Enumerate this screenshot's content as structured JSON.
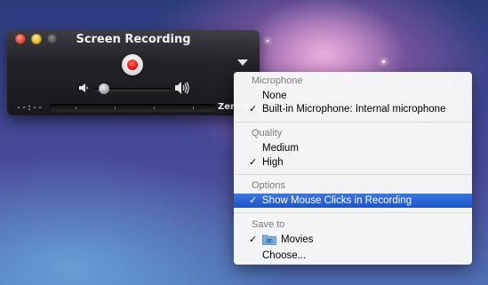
{
  "window": {
    "title": "Screen Recording",
    "time": "--:--",
    "size": "Zero KB"
  },
  "menu": {
    "sections": [
      {
        "header": "Microphone",
        "items": [
          {
            "label": "None",
            "checked": false
          },
          {
            "label": "Built-in Microphone: Internal microphone",
            "checked": true
          }
        ]
      },
      {
        "header": "Quality",
        "items": [
          {
            "label": "Medium",
            "checked": false
          },
          {
            "label": "High",
            "checked": true
          }
        ]
      },
      {
        "header": "Options",
        "items": [
          {
            "label": "Show Mouse Clicks in Recording",
            "checked": true,
            "highlighted": true
          }
        ]
      },
      {
        "header": "Save to",
        "items": [
          {
            "label": "Movies",
            "checked": true,
            "icon": "folder-icon"
          },
          {
            "label": "Choose...",
            "checked": false
          }
        ]
      }
    ],
    "check_glyph": "✓"
  },
  "colors": {
    "highlight": "#2a63d6",
    "record_red": "#e31b12"
  }
}
